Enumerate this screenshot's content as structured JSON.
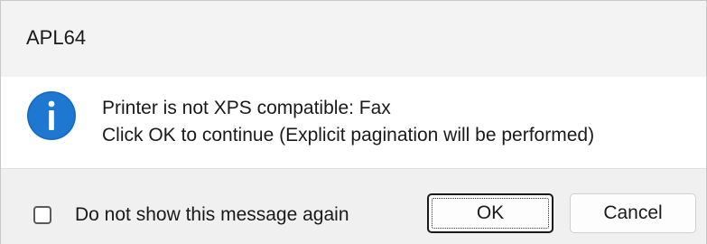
{
  "window": {
    "title": "APL64"
  },
  "message": {
    "icon": "info-icon",
    "line1": "Printer is not XPS compatible: Fax",
    "line2": "Click OK to continue (Explicit pagination will be performed)"
  },
  "footer": {
    "checkbox_label": "Do not show this message again",
    "checkbox_checked": false,
    "ok_label": "OK",
    "cancel_label": "Cancel"
  },
  "colors": {
    "icon_blue": "#1e78d2",
    "title_bar_bg": "#f3f3f3",
    "footer_bg": "#f0f0f0"
  }
}
